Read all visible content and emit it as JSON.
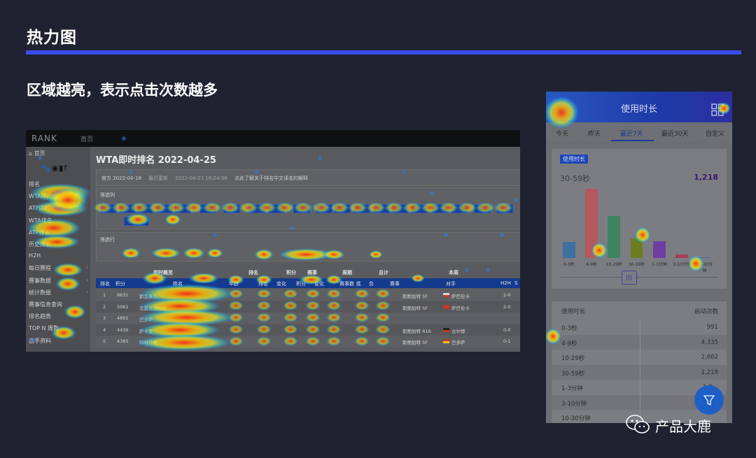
{
  "slide": {
    "title": "热力图",
    "subtitle": "区域越亮，表示点击次数越多",
    "accent": "#3b4cf0"
  },
  "desktop": {
    "logo": "RANK",
    "topbar_item": "首页",
    "home_link": "⌂ 首页",
    "social_icons": "🐾◉▮f",
    "page_title": "WTA即时排名 2022-04-25",
    "meta": {
      "official": "官方 2022-04-18",
      "updated_label": "最近更新",
      "updated": "2022-04-23 18:24:36",
      "note": "点此了解关于排名中文译名的解释"
    },
    "filter_country_label": "筛选列",
    "filter_row_label": "筛选行",
    "sidebar_items": [
      {
        "label": "排名"
      },
      {
        "label": "WTA即时排名"
      },
      {
        "label": "ATP即时排名"
      },
      {
        "label": "WTA排名"
      },
      {
        "label": "ATP排名"
      },
      {
        "label": "历史排名"
      },
      {
        "label": "H2H"
      },
      {
        "label": "每日赛程",
        "arrow": "›"
      },
      {
        "label": "赛事数据",
        "arrow": "›"
      },
      {
        "label": "统计数据",
        "arrow": "›"
      },
      {
        "label": "赛事信息查询"
      },
      {
        "label": "排名趋势"
      },
      {
        "label": "TOP N 周数"
      },
      {
        "label": "选手资料"
      }
    ],
    "group_headers": [
      "即时概览",
      "排名",
      "积分",
      "赛事",
      "周期",
      "总计",
      "本周"
    ],
    "table_headers": [
      "排名",
      "积分",
      "姓名",
      "年龄",
      "排名",
      "变化",
      "积分",
      "变化",
      "赛事数",
      "胜",
      "负",
      "赛事",
      "对手",
      "H2H",
      "S"
    ],
    "rows": [
      {
        "rank": "1",
        "points": "8631",
        "name": "斯瓦泰克",
        "tour": "斯图加特 SF",
        "opp": "萨巴伦卡",
        "h2h": "2-0"
      },
      {
        "rank": "2",
        "points": "5061",
        "name": "克雷吉茨科娃",
        "tour": "斯图加特 SF",
        "opp": "萨巴伦卡",
        "h2h": "2-0"
      },
      {
        "rank": "3",
        "points": "4891",
        "name": "巴多萨",
        "tour": "",
        "opp": "",
        "h2h": ""
      },
      {
        "rank": "4",
        "points": "4436",
        "name": "萨卡里",
        "tour": "斯图加特 R16",
        "opp": "古尔德",
        "h2h": "0-0"
      },
      {
        "rank": "5",
        "points": "4395",
        "name": "科维托娃",
        "tour": "斯图加特 SF",
        "opp": "巴多萨",
        "h2h": "0-1"
      }
    ]
  },
  "mobile": {
    "header_title": "使用时长",
    "tabs": [
      "今天",
      "昨天",
      "最近7天",
      "最近30天",
      "自定义"
    ],
    "active_tab": 2,
    "badge": "使用时长",
    "selected_category": "30-59秒",
    "selected_value": "1,218",
    "table_header_left": "使用时长",
    "table_header_right": "启动次数",
    "table_rows": [
      {
        "label": "0-3秒",
        "value": "991"
      },
      {
        "label": "4-9秒",
        "value": "4,335"
      },
      {
        "label": "10-29秒",
        "value": "2,662"
      },
      {
        "label": "30-59秒",
        "value": "1,218"
      },
      {
        "label": "1-3分钟",
        "value": "1,0…"
      },
      {
        "label": "3-10分钟",
        "value": ""
      },
      {
        "label": "10-30分钟",
        "value": ""
      }
    ]
  },
  "chart_data": {
    "type": "bar",
    "categories": [
      "0-3秒",
      "4-9秒",
      "10-29秒",
      "30-59秒",
      "1-3分钟",
      "3-10分钟",
      "10-30分钟"
    ],
    "values": [
      991,
      4335,
      2662,
      1218,
      1060,
      210,
      40
    ],
    "colors": [
      "#3d6fa0",
      "#b5585e",
      "#3f8460",
      "#6d7d1e",
      "#6e3fa0",
      "#a63d5a",
      "#3d6fa0"
    ],
    "ylim": [
      0,
      4400
    ],
    "title": "",
    "xlabel": "",
    "ylabel": ""
  },
  "watermark": {
    "text": "产品大鹿"
  }
}
